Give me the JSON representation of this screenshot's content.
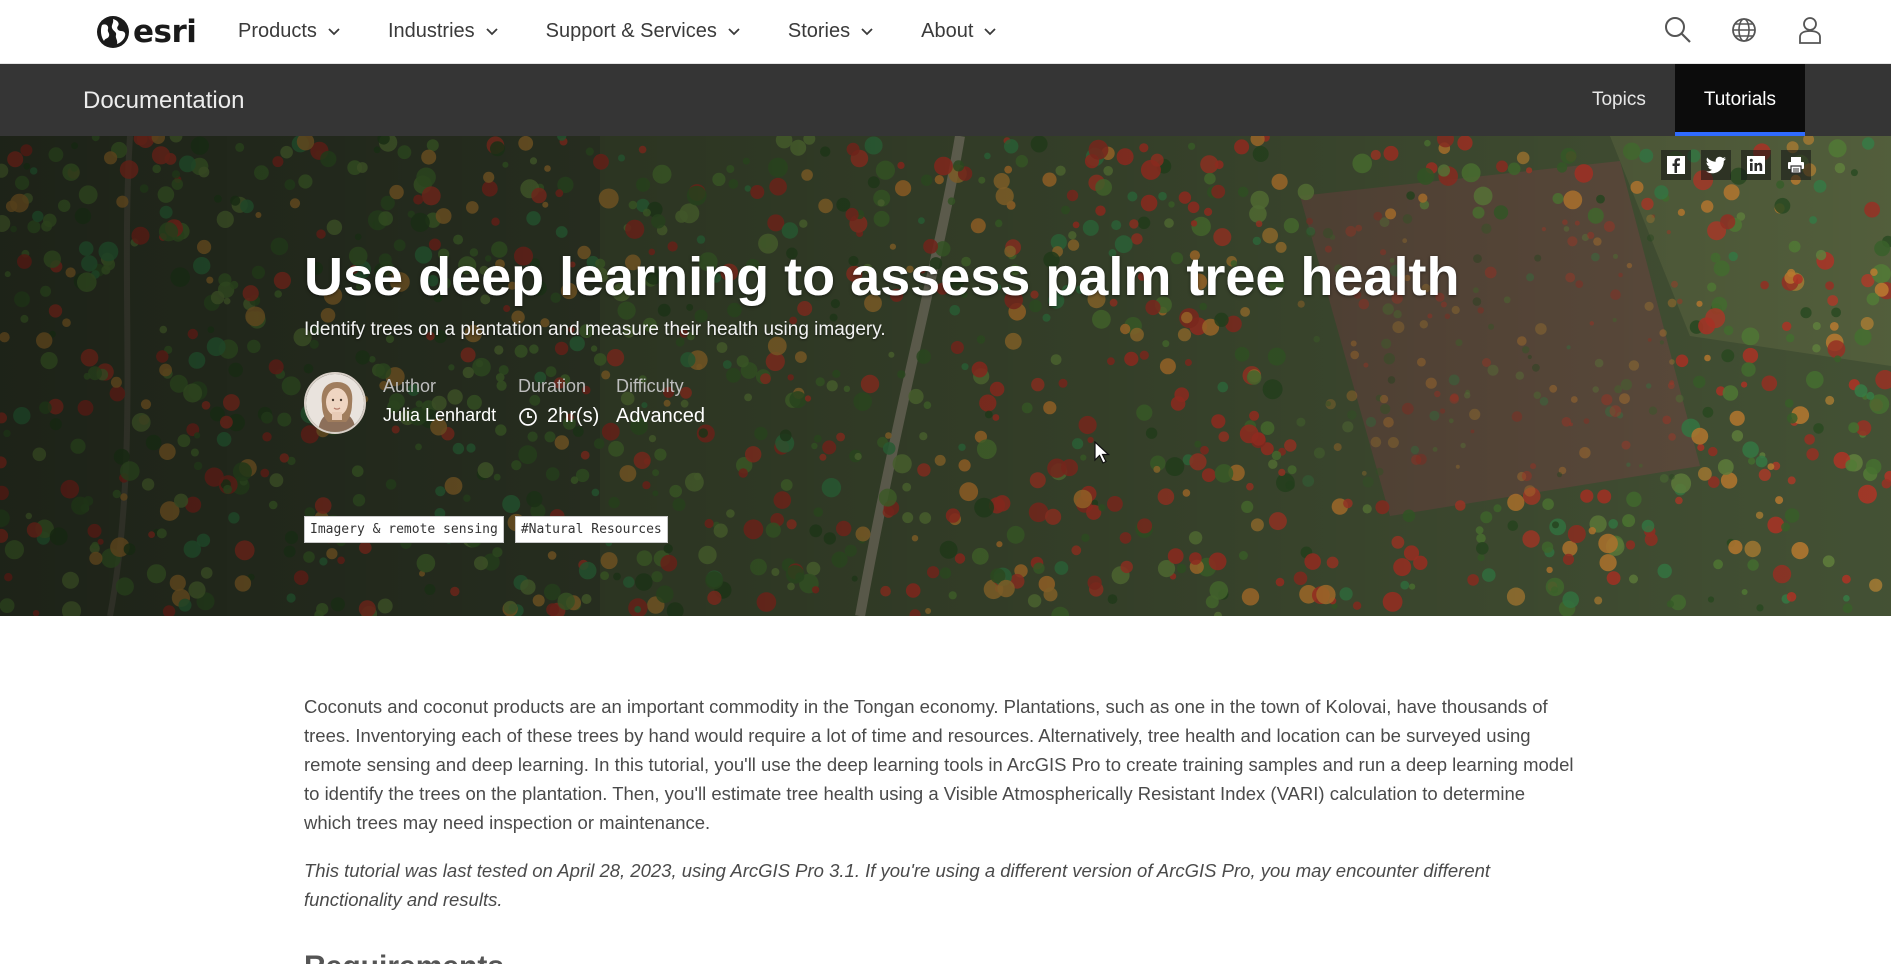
{
  "nav": {
    "brand": "esri",
    "items": [
      {
        "label": "Products"
      },
      {
        "label": "Industries"
      },
      {
        "label": "Support & Services"
      },
      {
        "label": "Stories"
      },
      {
        "label": "About"
      }
    ],
    "icons": [
      "search-icon",
      "globe-icon",
      "user-icon"
    ]
  },
  "docbar": {
    "title": "Documentation",
    "tabs": [
      {
        "label": "Topics",
        "active": false
      },
      {
        "label": "Tutorials",
        "active": true
      }
    ],
    "accent": "#2f6bff"
  },
  "hero": {
    "title": "Use deep learning to assess palm tree health",
    "subtitle": "Identify trees on a plantation and measure their health using imagery.",
    "author_label": "Author",
    "author": "Julia Lenhardt",
    "duration_label": "Duration",
    "duration": "2hr(s)",
    "difficulty_label": "Difficulty",
    "difficulty": "Advanced",
    "tags": [
      "Imagery & remote sensing",
      "#Natural Resources"
    ],
    "share_icons": [
      "facebook-icon",
      "twitter-icon",
      "linkedin-icon",
      "print-icon"
    ]
  },
  "content": {
    "intro": "Coconuts and coconut products are an important commodity in the Tongan economy. Plantations, such as one in the town of Kolovai, have thousands of trees. Inventorying each of these trees by hand would require a lot of time and resources. Alternatively, tree health and location can be surveyed using remote sensing and deep learning. In this tutorial, you'll use the deep learning tools in ArcGIS Pro to create training samples and run a deep learning model to identify the trees on the plantation. Then, you'll estimate tree health using a Visible Atmospherically Resistant Index (VARI) calculation to determine which trees may need inspection or maintenance.",
    "note": "This tutorial was last tested on April 28, 2023, using ArcGIS Pro 3.1. If you're using a different version of ArcGIS Pro, you may encounter different functionality and results.",
    "next_heading": "Requirements"
  }
}
